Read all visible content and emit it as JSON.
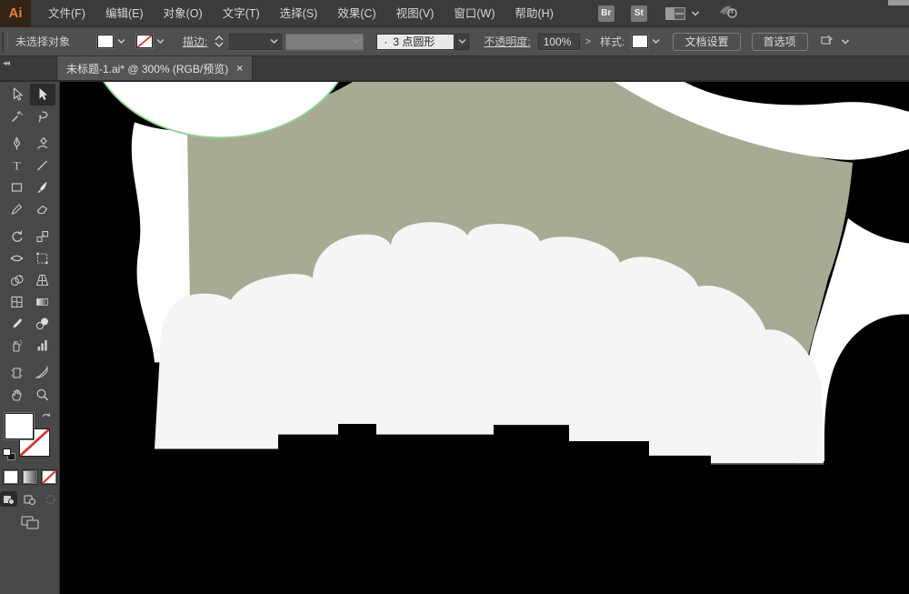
{
  "menubar": {
    "logo": "Ai",
    "items": [
      {
        "label": "文件(F)"
      },
      {
        "label": "编辑(E)"
      },
      {
        "label": "对象(O)"
      },
      {
        "label": "文字(T)"
      },
      {
        "label": "选择(S)"
      },
      {
        "label": "效果(C)"
      },
      {
        "label": "视图(V)"
      },
      {
        "label": "窗口(W)"
      },
      {
        "label": "帮助(H)"
      }
    ],
    "bridge_button": "Br",
    "stock_button": "St"
  },
  "control_bar": {
    "selection_status": "未选择对象",
    "stroke_label": "描边:",
    "stroke_width_value": "",
    "brush_bullet": "·",
    "brush_value": "3 点圆形",
    "opacity_label": "不透明度:",
    "opacity_value": "100%",
    "opacity_expand": ">",
    "style_label": "样式:",
    "document_setup_button": "文档设置",
    "preferences_button": "首选项"
  },
  "tabbar": {
    "collapse_glyph": "◂◂",
    "document_tab": {
      "title": "未标题-1.ai* @ 300% (RGB/预览)",
      "close": "×"
    }
  },
  "toolbar": {
    "active_tool": "direct-selection",
    "tool_groups": [
      [
        "selection",
        "direct-selection",
        "magic-wand",
        "lasso"
      ],
      [
        "pen",
        "curvature",
        "type",
        "line-segment",
        "rectangle",
        "paintbrush",
        "pencil",
        "eraser"
      ],
      [
        "rotate",
        "scale",
        "width",
        "free-transform",
        "shape-builder",
        "perspective-grid",
        "mesh",
        "gradient",
        "eyedropper",
        "blend",
        "symbol-sprayer",
        "column-graph"
      ],
      [
        "artboard",
        "slice",
        "hand",
        "zoom"
      ]
    ]
  },
  "canvas": {
    "zoom_level": "300%",
    "colors": {
      "background": "#000000",
      "sage": "#a9aa94",
      "cloud": "#f5f5f6",
      "white": "#ffffff",
      "green_stroke": "#8dd491",
      "shadow_line": "#555555"
    }
  }
}
